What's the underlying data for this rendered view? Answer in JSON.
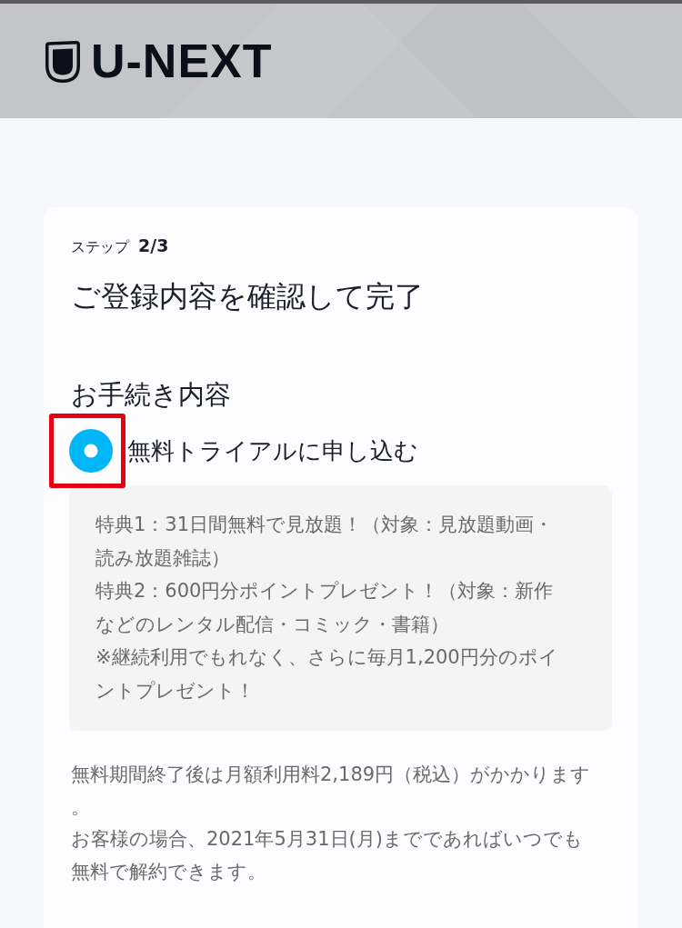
{
  "header": {
    "logo": "U-NEXT"
  },
  "step": {
    "label": "ステップ",
    "value": "2/3"
  },
  "title": "ご登録内容を確認して完了",
  "section": {
    "heading": "お手続き内容",
    "options": [
      {
        "label": "無料トライアルに申し込む",
        "selected": true,
        "highlighted": true
      }
    ],
    "benefits": [
      "特典1：31日間無料で見放題！（対象：見放題動画・読み放題雑誌）",
      "特典2：600円分ポイントプレゼント！（対象：新作などのレンタル配信・コミック・書籍）",
      "※継続利用でもれなく、さらに毎月1,200円分のポイントプレゼント！"
    ]
  },
  "notes": [
    "無料期間終了後は月額利用料2,189円（税込）がかかります。",
    "お客様の場合、2021年5月31日(月)までであればいつでも無料で解約できます。"
  ]
}
